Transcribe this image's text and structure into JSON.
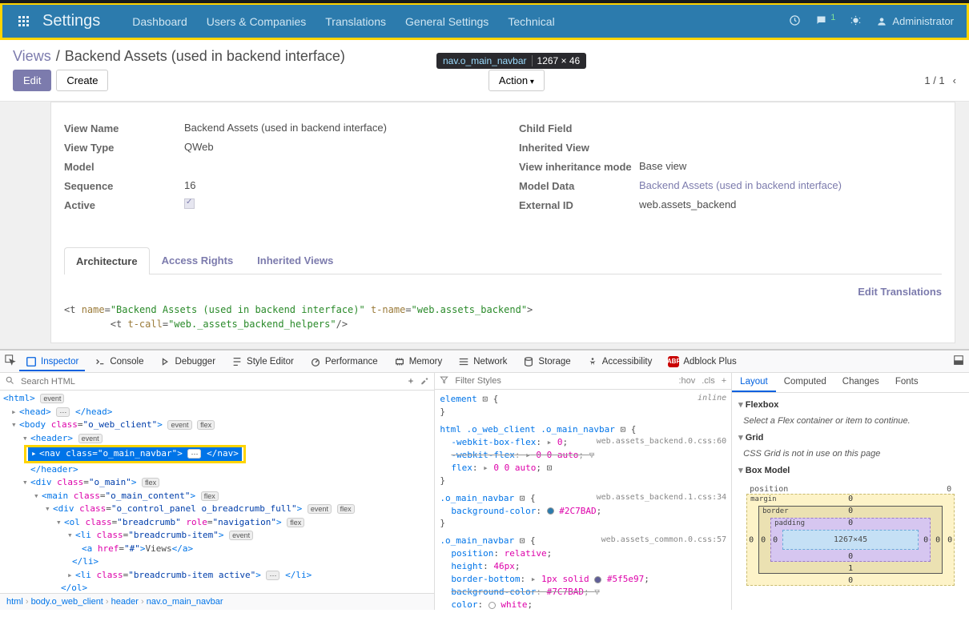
{
  "navbar": {
    "brand": "Settings",
    "items": [
      "Dashboard",
      "Users & Companies",
      "Translations",
      "General Settings",
      "Technical"
    ],
    "user": "Administrator",
    "messages_badge": "1"
  },
  "node_tooltip": {
    "selector": "nav.o_main_navbar",
    "dimensions": "1267 × 46"
  },
  "breadcrumb": {
    "root": "Views",
    "sep": "/",
    "active": "Backend Assets (used in backend interface)"
  },
  "actions": {
    "edit": "Edit",
    "create": "Create",
    "action": "Action",
    "pager": "1 / 1"
  },
  "form": {
    "left": {
      "view_name": {
        "label": "View Name",
        "value": "Backend Assets (used in backend interface)"
      },
      "view_type": {
        "label": "View Type",
        "value": "QWeb"
      },
      "model": {
        "label": "Model",
        "value": ""
      },
      "sequence": {
        "label": "Sequence",
        "value": "16"
      },
      "active": {
        "label": "Active",
        "checked": true
      }
    },
    "right": {
      "child_field": {
        "label": "Child Field",
        "value": ""
      },
      "inherited_view": {
        "label": "Inherited View",
        "value": ""
      },
      "inherit_mode": {
        "label": "View inheritance mode",
        "value": "Base view"
      },
      "model_data": {
        "label": "Model Data",
        "value": "Backend Assets (used in backend interface)"
      },
      "external_id": {
        "label": "External ID",
        "value": "web.assets_backend"
      }
    }
  },
  "tabs": {
    "architecture": "Architecture",
    "access_rights": "Access Rights",
    "inherited_views": "Inherited Views",
    "edit_translations": "Edit Translations"
  },
  "arch_code": {
    "l1_pre": "<t ",
    "l1_a1n": "name",
    "l1_a1v": "\"Backend Assets (used in backend interface)\"",
    "l1_a2n": "t-name",
    "l1_a2v": "\"web.assets_backend\"",
    "l1_post": ">",
    "l2_pre": "        <t ",
    "l2_a1n": "t-call",
    "l2_a1v": "\"web._assets_backend_helpers\"",
    "l2_post": "/>"
  },
  "devtools": {
    "tabs": {
      "inspector": "Inspector",
      "console": "Console",
      "debugger": "Debugger",
      "style_editor": "Style Editor",
      "performance": "Performance",
      "memory": "Memory",
      "network": "Network",
      "storage": "Storage",
      "accessibility": "Accessibility",
      "adblock": "Adblock Plus"
    },
    "search_placeholder": "Search HTML",
    "filter_placeholder": "Filter Styles",
    "toggles": {
      "hov": ":hov",
      "cls": ".cls"
    },
    "tree": {
      "html": "<html>",
      "head_open": "<head>",
      "head_dots": "⋯",
      "head_close": "</head>",
      "body": "<body class=\"o_web_client\">",
      "header": "<header>",
      "header_close": "</header>",
      "nav_open": "<nav class=\"o_main_navbar\">",
      "nav_dots": "⋯",
      "nav_close": "</nav>",
      "o_main": "<div class=\"o_main\">",
      "main_content": "<main class=\"o_main_content\">",
      "ctrl": "<div class=\"o_control_panel o_breadcrumb_full\">",
      "ol": "<ol class=\"breadcrumb\" role=\"navigation\">",
      "li1": "<li class=\"breadcrumb-item\">",
      "a": "<a href=\"#\">Views</a>",
      "li1_close": "</li>",
      "li2": "<li class=\"breadcrumb-item active\">",
      "li2_dots": "⋯",
      "li2_close": "</li>",
      "ol_close": "</ol>",
      "badges": {
        "event": "event",
        "flex": "flex"
      }
    },
    "rules": {
      "r0_sel": "element",
      "r0_inline": "inline",
      "r1_sel": "html .o_web_client .o_main_navbar",
      "r1_src": "web.assets_backend.0.css:60",
      "r1_p1n": "-webkit-box-flex",
      "r1_p1v": "0",
      "r1_p2n": "-webkit-flex",
      "r1_p2v": "0 0 auto",
      "r1_p3n": "flex",
      "r1_p3v": "0 0 auto",
      "r2_sel": ".o_main_navbar",
      "r2_src": "web.assets_backend.1.css:34",
      "r2_p1n": "background-color",
      "r2_p1v": "#2C7BAD",
      "r3_sel": ".o_main_navbar",
      "r3_src": "web.assets_common.0.css:57",
      "r3_p1n": "position",
      "r3_p1v": "relative",
      "r3_p2n": "height",
      "r3_p2v": "46px",
      "r3_p3n": "border-bottom",
      "r3_p3v": "1px solid ",
      "r3_p3v2": "#5f5e97",
      "r3_p4n": "background-color",
      "r3_p4v": "#7C7BAD",
      "r3_p5n": "color",
      "r3_p5v": "white"
    },
    "layout": {
      "tabs": {
        "layout": "Layout",
        "computed": "Computed",
        "changes": "Changes",
        "fonts": "Fonts"
      },
      "flexbox": {
        "title": "Flexbox",
        "msg": "Select a Flex container or item to continue."
      },
      "grid": {
        "title": "Grid",
        "msg": "CSS Grid is not in use on this page"
      },
      "boxmodel": {
        "title": "Box Model",
        "position_label": "position",
        "position_val": "0",
        "margin_label": "margin",
        "margin_t": "0",
        "margin_r": "0",
        "margin_b": "0",
        "margin_l": "0",
        "border_label": "border",
        "border_t": "0",
        "border_r": "0",
        "border_b": "1",
        "border_l": "0",
        "padding_label": "padding",
        "padding_t": "0",
        "padding_r": "0",
        "padding_b": "0",
        "padding_l": "0",
        "content": "1267×45"
      }
    },
    "crumb": {
      "c1": "html",
      "c2": "body.o_web_client",
      "c3": "header",
      "c4": "nav.o_main_navbar"
    }
  }
}
